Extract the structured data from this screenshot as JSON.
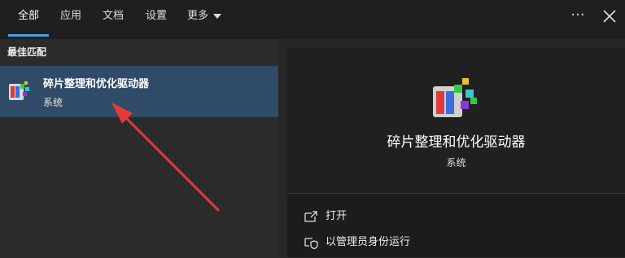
{
  "tabs": [
    {
      "label": "全部"
    },
    {
      "label": "应用"
    },
    {
      "label": "文档"
    },
    {
      "label": "设置"
    },
    {
      "label": "更多"
    }
  ],
  "more_menu_icon": "ellipsis-icon",
  "close_icon": "close-icon",
  "section_title": "最佳匹配",
  "best_match": {
    "name": "碎片整理和优化驱动器",
    "category": "系统",
    "icon": "defrag-app-icon"
  },
  "detail": {
    "name": "碎片整理和优化驱动器",
    "category": "系统",
    "icon": "defrag-app-icon"
  },
  "actions": [
    {
      "label": "打开",
      "icon": "open-icon"
    },
    {
      "label": "以管理员身份运行",
      "icon": "shield-run-icon"
    }
  ],
  "colors": {
    "accent": "#4c9ce8",
    "selected": "#2f4b67",
    "annotation_arrow": "#e33a3a"
  }
}
